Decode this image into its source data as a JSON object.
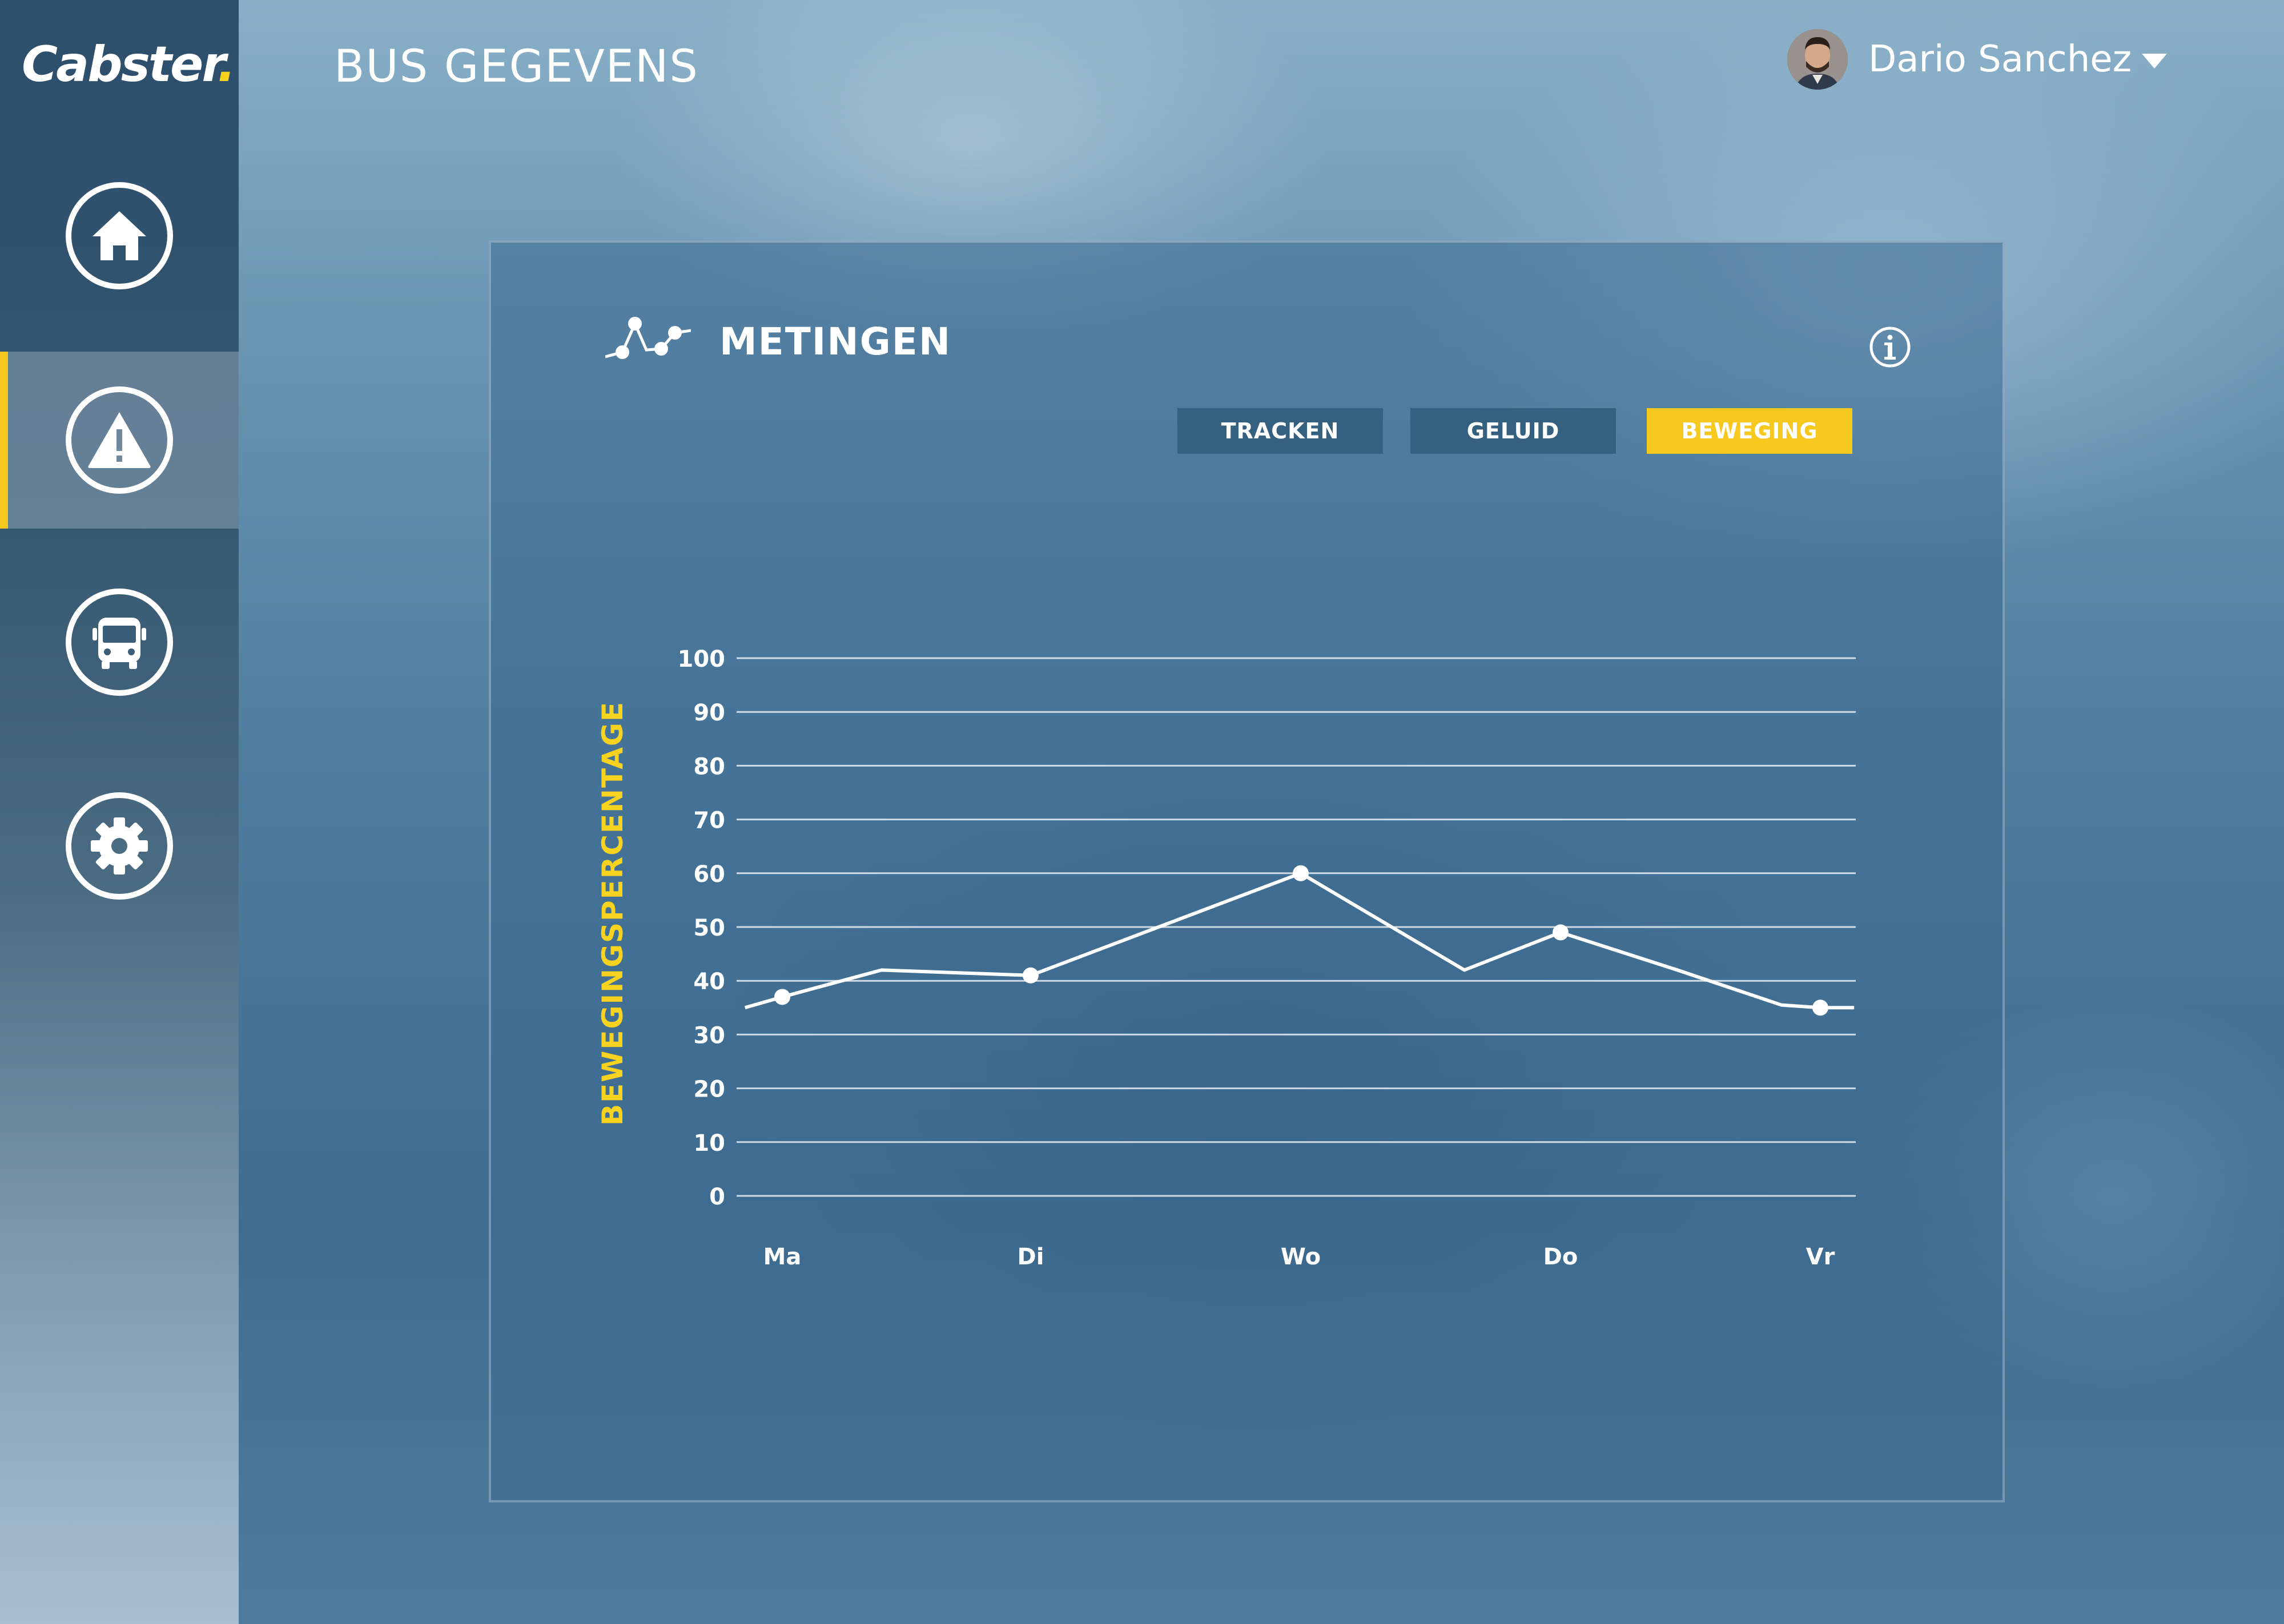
{
  "app": {
    "logo_text": "Cabster",
    "logo_dot": ".",
    "accent": "#f7c81e"
  },
  "header": {
    "title": "BUS GEGEVENS"
  },
  "user": {
    "name": "Dario Sanchez"
  },
  "sidebar": {
    "items": [
      {
        "name": "home",
        "icon": "home-icon",
        "active": false
      },
      {
        "name": "alerts",
        "icon": "warning-icon",
        "active": true
      },
      {
        "name": "bus",
        "icon": "bus-icon",
        "active": false
      },
      {
        "name": "settings",
        "icon": "gear-icon",
        "active": false
      }
    ]
  },
  "panel": {
    "title": "METINGEN",
    "tabs": [
      {
        "label": "TRACKEN",
        "active": false
      },
      {
        "label": "GELUID",
        "active": false
      },
      {
        "label": "BEWEGING",
        "active": true
      }
    ]
  },
  "chart_data": {
    "type": "line",
    "title": "",
    "xlabel": "",
    "ylabel": "BEWEGINGSPERCENTAGE",
    "ylim": [
      0,
      100
    ],
    "yticks": [
      0,
      10,
      20,
      30,
      40,
      50,
      60,
      70,
      80,
      90,
      100
    ],
    "grid": true,
    "categories": [
      "Ma",
      "Di",
      "Wo",
      "Do",
      "Vr"
    ],
    "series": [
      {
        "line_points": [
          {
            "x": -0.15,
            "y": 35
          },
          {
            "x": 0,
            "y": 37
          },
          {
            "x": 0.4,
            "y": 42
          },
          {
            "x": 1,
            "y": 41
          },
          {
            "x": 2,
            "y": 60
          },
          {
            "x": 2.63,
            "y": 42
          },
          {
            "x": 3,
            "y": 49
          },
          {
            "x": 3.45,
            "y": 42
          },
          {
            "x": 3.85,
            "y": 35.5
          },
          {
            "x": 4,
            "y": 35
          },
          {
            "x": 4.13,
            "y": 35
          }
        ],
        "markers": [
          {
            "x": 0,
            "y": 37
          },
          {
            "x": 1,
            "y": 41
          },
          {
            "x": 2,
            "y": 60
          },
          {
            "x": 3,
            "y": 49
          },
          {
            "x": 4,
            "y": 35
          }
        ]
      }
    ]
  }
}
